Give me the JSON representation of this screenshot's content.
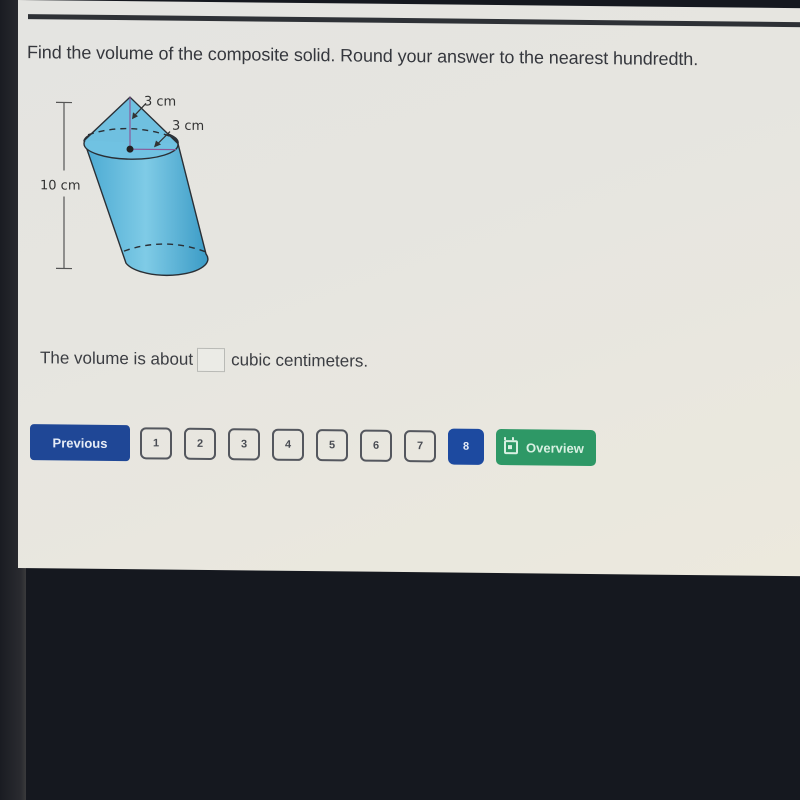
{
  "question": {
    "prompt": "Find the volume of the composite solid. Round your answer to the nearest hundredth."
  },
  "figure": {
    "description": "oblique cylinder topped with a cone",
    "labels": {
      "cone_height": "3 cm",
      "radius": "3 cm",
      "cylinder_height": "10 cm"
    },
    "colors": {
      "solid_fill": "#5bb8dc",
      "solid_stroke": "#2a2f35"
    }
  },
  "answer": {
    "prefix": "The volume is about",
    "value": "",
    "suffix": "cubic centimeters."
  },
  "navigation": {
    "previous_label": "Previous",
    "pages": [
      "1",
      "2",
      "3",
      "4",
      "5",
      "6",
      "7",
      "8"
    ],
    "current_page": "8",
    "overview_label": "Overview",
    "colors": {
      "primary": "#1f4796",
      "overview": "#2e9866"
    }
  }
}
